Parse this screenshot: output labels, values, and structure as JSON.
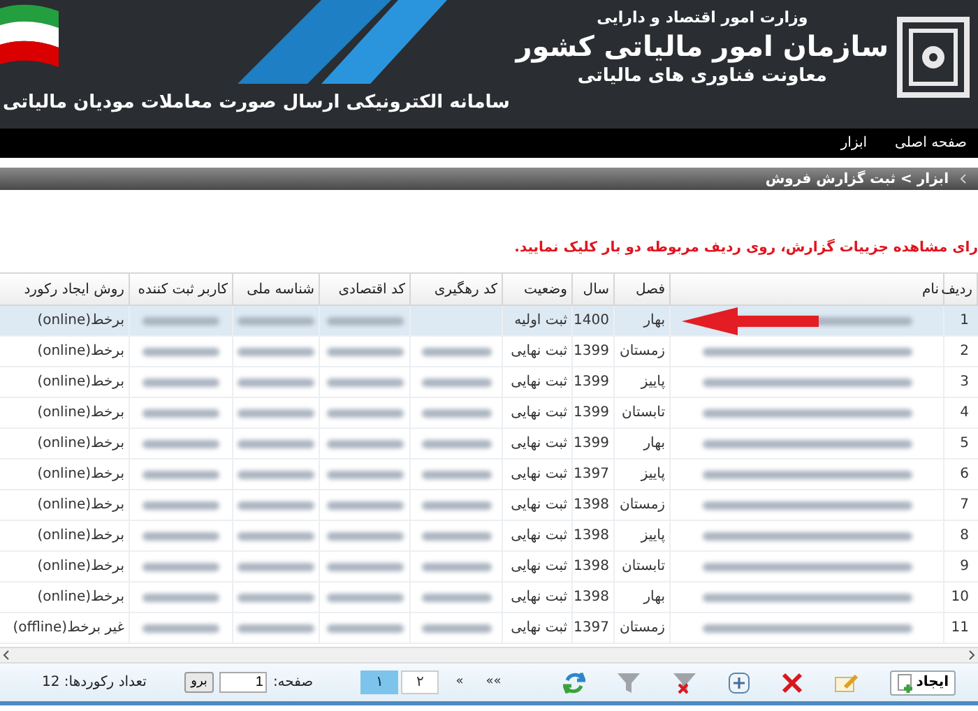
{
  "banner": {
    "ministry": "وزارت امور اقتصاد و دارایی",
    "organization": "سازمان امور مالیاتی کشور",
    "deputy": "معاونت فناوری های مالیاتی",
    "system": "سامانه الکترونیکی ارسال صورت معاملات مودیان مالیاتی"
  },
  "nav": [
    {
      "label": "صفحه اصلی"
    },
    {
      "label": "ابزار"
    }
  ],
  "breadcrumb": "ابزار > ثبت گزارش فروش",
  "instruction": "رای مشاهده جزییات گزارش، روی ردیف مربوطه دو بار کلیک نمایید.",
  "table": {
    "columns": [
      "ردیف",
      "نام",
      "فصل",
      "سال",
      "وضعیت",
      "کد رهگیری",
      "کد اقتصادی",
      "شناسه ملی",
      "کاربر ثبت کننده",
      "روش ایجاد رکورد"
    ],
    "rows": [
      {
        "row": "1",
        "season": "بهار",
        "year": "1400",
        "status": "ثبت اولیه",
        "method": "برخط(online)",
        "selected": true,
        "tracking_code_blurred": false
      },
      {
        "row": "2",
        "season": "زمستان",
        "year": "1399",
        "status": "ثبت نهایی",
        "method": "برخط(online)",
        "selected": false,
        "tracking_code_blurred": true
      },
      {
        "row": "3",
        "season": "پاییز",
        "year": "1399",
        "status": "ثبت نهایی",
        "method": "برخط(online)",
        "selected": false,
        "tracking_code_blurred": true
      },
      {
        "row": "4",
        "season": "تابستان",
        "year": "1399",
        "status": "ثبت نهایی",
        "method": "برخط(online)",
        "selected": false,
        "tracking_code_blurred": true
      },
      {
        "row": "5",
        "season": "بهار",
        "year": "1399",
        "status": "ثبت نهایی",
        "method": "برخط(online)",
        "selected": false,
        "tracking_code_blurred": true
      },
      {
        "row": "6",
        "season": "پاییز",
        "year": "1397",
        "status": "ثبت نهایی",
        "method": "برخط(online)",
        "selected": false,
        "tracking_code_blurred": true
      },
      {
        "row": "7",
        "season": "زمستان",
        "year": "1398",
        "status": "ثبت نهایی",
        "method": "برخط(online)",
        "selected": false,
        "tracking_code_blurred": true
      },
      {
        "row": "8",
        "season": "پاییز",
        "year": "1398",
        "status": "ثبت نهایی",
        "method": "برخط(online)",
        "selected": false,
        "tracking_code_blurred": true
      },
      {
        "row": "9",
        "season": "تابستان",
        "year": "1398",
        "status": "ثبت نهایی",
        "method": "برخط(online)",
        "selected": false,
        "tracking_code_blurred": true
      },
      {
        "row": "10",
        "season": "بهار",
        "year": "1398",
        "status": "ثبت نهایی",
        "method": "برخط(online)",
        "selected": false,
        "tracking_code_blurred": true
      },
      {
        "row": "11",
        "season": "زمستان",
        "year": "1397",
        "status": "ثبت نهایی",
        "method": "غیر برخط(offline)",
        "selected": false,
        "tracking_code_blurred": true
      }
    ]
  },
  "toolbar": [
    {
      "kind": "create",
      "label": "ایجاد"
    },
    {
      "kind": "edit"
    },
    {
      "kind": "delete"
    },
    {
      "kind": "add"
    },
    {
      "kind": "clear_filter"
    },
    {
      "kind": "filter"
    },
    {
      "kind": "refresh"
    }
  ],
  "pager": {
    "nav": [
      "»»",
      "»"
    ],
    "pages": [
      {
        "label": "۲",
        "selected": false
      },
      {
        "label": "۱",
        "selected": true
      }
    ],
    "page_label": "صفحه:",
    "page_value": "1",
    "go": "برو",
    "record_count": "تعداد رکوردها: 12"
  }
}
